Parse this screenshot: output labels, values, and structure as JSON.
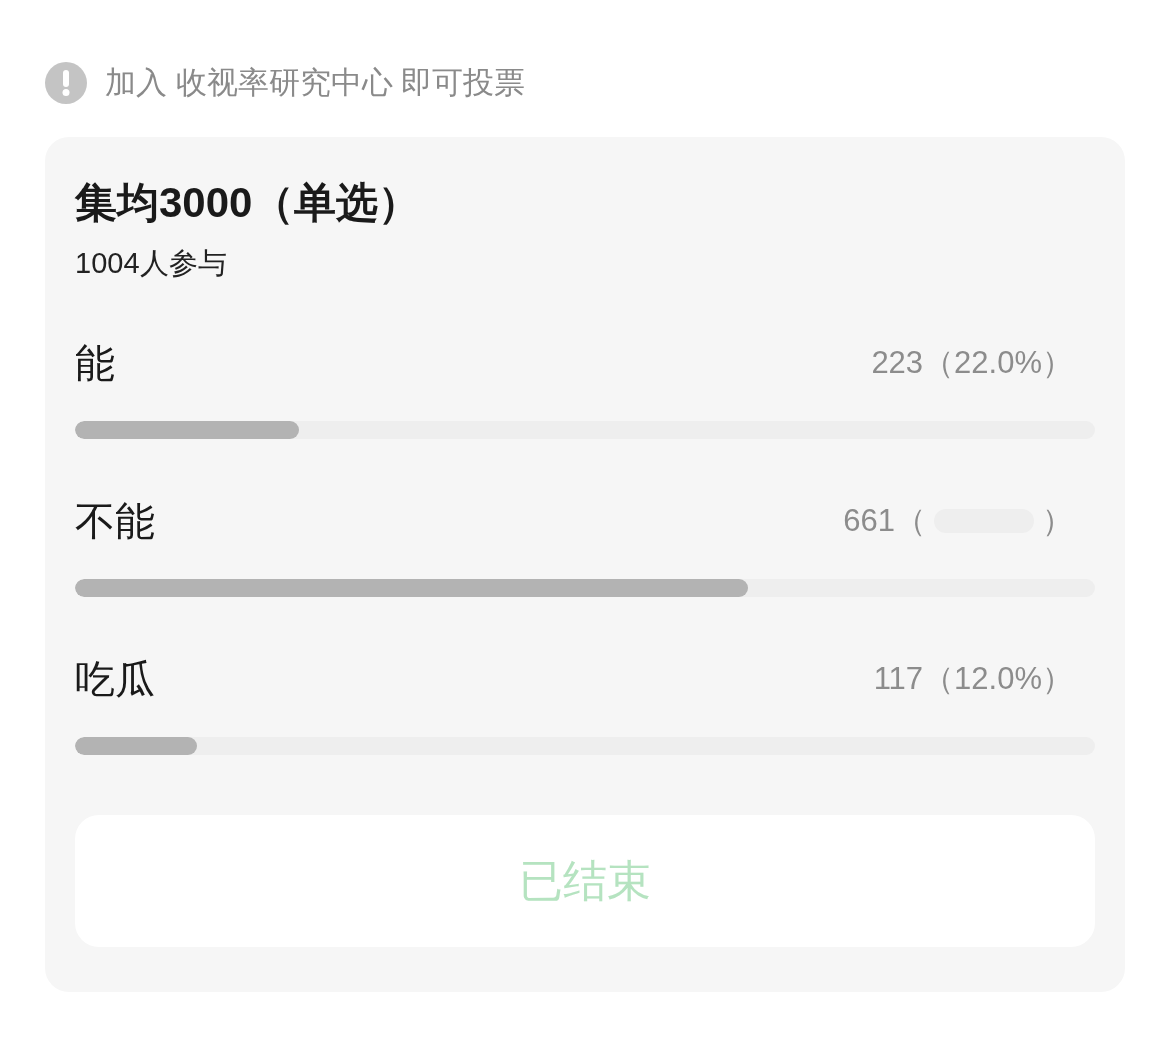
{
  "notice": {
    "text": "加入 收视率研究中心 即可投票"
  },
  "poll": {
    "title": "集均3000（单选）",
    "participants": "1004人参与",
    "options": [
      {
        "label": "能",
        "reading": "223（22.0%）",
        "redacted": false,
        "level": 0.22
      },
      {
        "label": "不能",
        "reading": "661（",
        "reading_end": "）",
        "redacted": true,
        "level": 0.66
      },
      {
        "label": "吃瓜",
        "reading": "117（12.0%）",
        "redacted": false,
        "level": 0.12
      }
    ],
    "button": {
      "label": "已结束",
      "disabled": true
    }
  }
}
